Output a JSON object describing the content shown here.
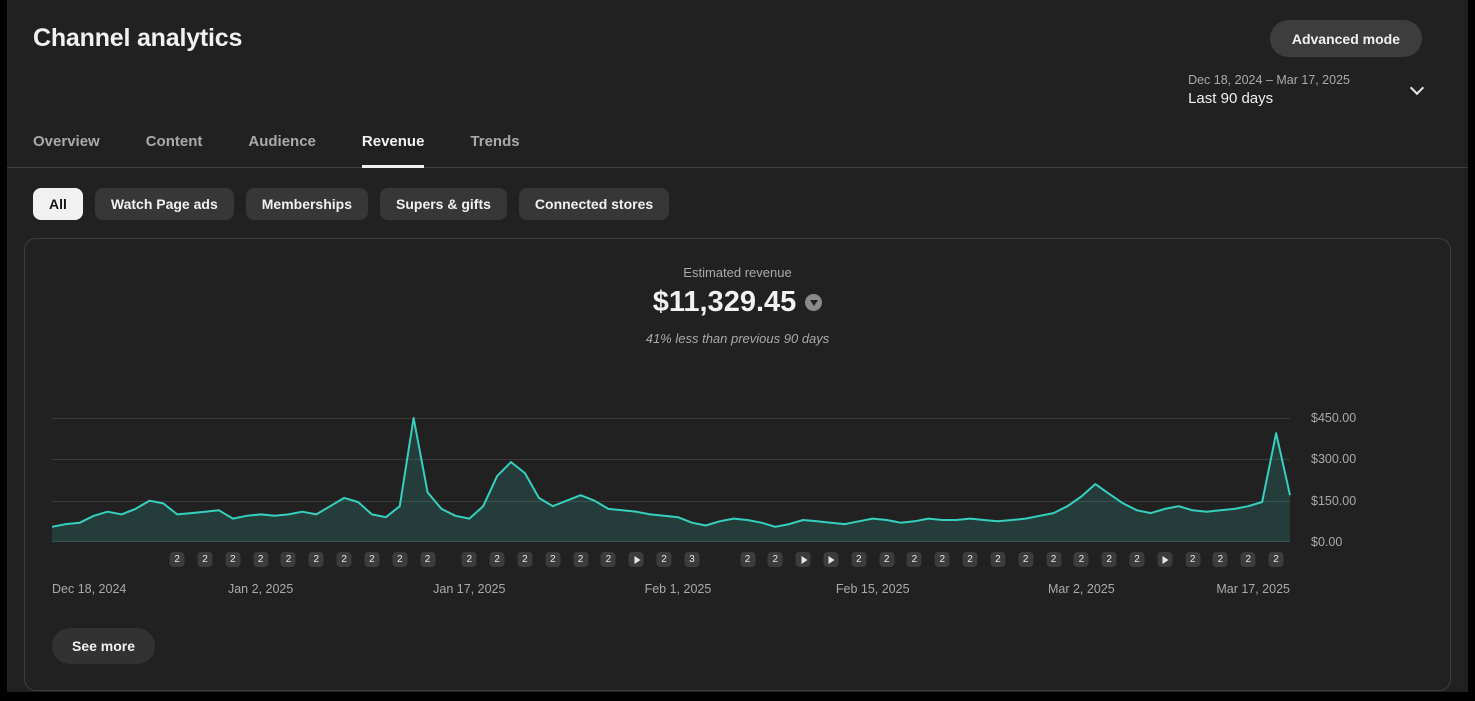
{
  "header": {
    "title": "Channel analytics",
    "advanced_mode_label": "Advanced mode"
  },
  "date_range": {
    "range": "Dec 18, 2024 – Mar 17, 2025",
    "preset": "Last 90 days"
  },
  "tabs": [
    {
      "label": "Overview",
      "active": false
    },
    {
      "label": "Content",
      "active": false
    },
    {
      "label": "Audience",
      "active": false
    },
    {
      "label": "Revenue",
      "active": true
    },
    {
      "label": "Trends",
      "active": false
    }
  ],
  "filters": [
    {
      "label": "All",
      "selected": true
    },
    {
      "label": "Watch Page ads",
      "selected": false
    },
    {
      "label": "Memberships",
      "selected": false
    },
    {
      "label": "Supers & gifts",
      "selected": false
    },
    {
      "label": "Connected stores",
      "selected": false
    }
  ],
  "revenue": {
    "metric_label": "Estimated revenue",
    "value": "$11,329.45",
    "comparison": "41% less than previous 90 days"
  },
  "see_more_label": "See more",
  "chart_data": {
    "type": "area",
    "title": "Estimated revenue",
    "unit": "USD",
    "ylim": [
      0,
      450
    ],
    "grid": true,
    "line_color": "#35d0bf",
    "area_fill": "rgba(53,208,191,0.16)",
    "x_start": "Dec 18, 2024",
    "x_end": "Mar 17, 2025",
    "x_tick_labels": [
      "Dec 18, 2024",
      "Jan 2, 2025",
      "Jan 17, 2025",
      "Feb 1, 2025",
      "Feb 15, 2025",
      "Mar 2, 2025",
      "Mar 17, 2025"
    ],
    "x_tick_days": [
      0,
      15,
      30,
      45,
      59,
      74,
      89
    ],
    "y_tick_labels": [
      "$450.00",
      "$300.00",
      "$150.00",
      "$0.00"
    ],
    "values": [
      55,
      65,
      70,
      95,
      110,
      100,
      120,
      150,
      140,
      100,
      105,
      110,
      115,
      85,
      95,
      100,
      95,
      100,
      110,
      100,
      130,
      160,
      145,
      100,
      90,
      130,
      450,
      180,
      120,
      95,
      85,
      130,
      240,
      290,
      250,
      160,
      130,
      150,
      170,
      150,
      120,
      115,
      110,
      100,
      95,
      90,
      70,
      60,
      75,
      85,
      80,
      70,
      55,
      65,
      80,
      75,
      70,
      65,
      75,
      85,
      80,
      70,
      75,
      85,
      80,
      80,
      85,
      80,
      75,
      80,
      85,
      95,
      105,
      130,
      165,
      210,
      175,
      140,
      115,
      105,
      120,
      130,
      115,
      110,
      115,
      120,
      130,
      145,
      395,
      170
    ],
    "markers": [
      {
        "day": 9,
        "label": "2"
      },
      {
        "day": 11,
        "label": "2"
      },
      {
        "day": 13,
        "label": "2"
      },
      {
        "day": 15,
        "label": "2"
      },
      {
        "day": 17,
        "label": "2"
      },
      {
        "day": 19,
        "label": "2"
      },
      {
        "day": 21,
        "label": "2"
      },
      {
        "day": 23,
        "label": "2"
      },
      {
        "day": 25,
        "label": "2"
      },
      {
        "day": 27,
        "label": "2"
      },
      {
        "day": 30,
        "label": "2"
      },
      {
        "day": 32,
        "label": "2"
      },
      {
        "day": 34,
        "label": "2"
      },
      {
        "day": 36,
        "label": "2"
      },
      {
        "day": 38,
        "label": "2"
      },
      {
        "day": 40,
        "label": "2"
      },
      {
        "day": 42,
        "label": "play"
      },
      {
        "day": 44,
        "label": "2"
      },
      {
        "day": 46,
        "label": "3"
      },
      {
        "day": 50,
        "label": "2"
      },
      {
        "day": 52,
        "label": "2"
      },
      {
        "day": 54,
        "label": "play"
      },
      {
        "day": 56,
        "label": "play"
      },
      {
        "day": 58,
        "label": "2"
      },
      {
        "day": 60,
        "label": "2"
      },
      {
        "day": 62,
        "label": "2"
      },
      {
        "day": 64,
        "label": "2"
      },
      {
        "day": 66,
        "label": "2"
      },
      {
        "day": 68,
        "label": "2"
      },
      {
        "day": 70,
        "label": "2"
      },
      {
        "day": 72,
        "label": "2"
      },
      {
        "day": 74,
        "label": "2"
      },
      {
        "day": 76,
        "label": "2"
      },
      {
        "day": 78,
        "label": "2"
      },
      {
        "day": 80,
        "label": "play"
      },
      {
        "day": 82,
        "label": "2"
      },
      {
        "day": 84,
        "label": "2"
      },
      {
        "day": 86,
        "label": "2"
      },
      {
        "day": 88,
        "label": "2"
      }
    ]
  }
}
